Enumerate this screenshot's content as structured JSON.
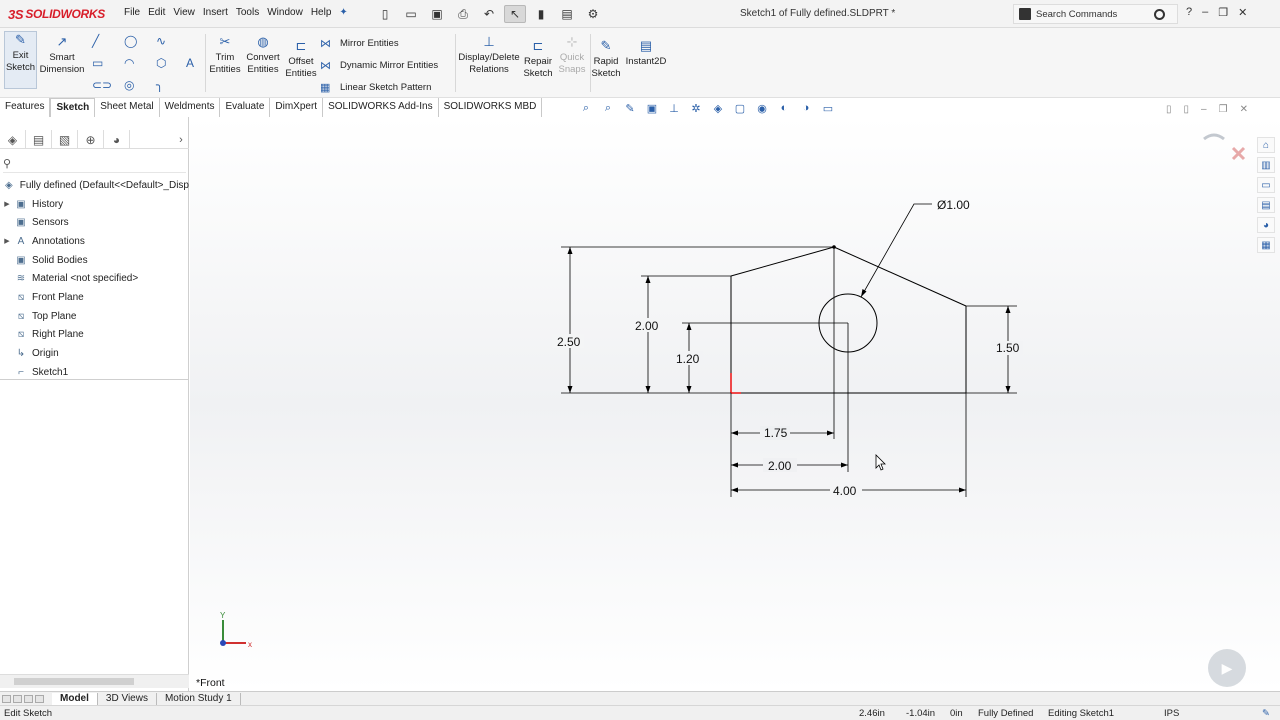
{
  "app": {
    "logo_text": "SOLIDWORKS",
    "doc_title": "Sketch1 of Fully defined.SLDPRT *",
    "menu": [
      "File",
      "Edit",
      "View",
      "Insert",
      "Tools",
      "Window",
      "Help"
    ],
    "search_placeholder": "Search Commands",
    "accent_color": "#d81e2a"
  },
  "ribbon": {
    "exit_sketch": "Exit Sketch",
    "smart_dimension": "Smart Dimension",
    "trim_entities": "Trim Entities",
    "convert_entities": "Convert Entities",
    "offset_entities": "Offset Entities",
    "mirror_entities": "Mirror Entities",
    "dynamic_mirror": "Dynamic Mirror Entities",
    "linear_pattern": "Linear Sketch Pattern",
    "display_delete_relations": "Display/Delete Relations",
    "repair_sketch": "Repair Sketch",
    "quick_snaps": "Quick Snaps",
    "rapid_sketch": "Rapid Sketch",
    "instant2d": "Instant2D"
  },
  "tabs": [
    "Features",
    "Sketch",
    "Sheet Metal",
    "Weldments",
    "Evaluate",
    "DimXpert",
    "SOLIDWORKS Add-Ins",
    "SOLIDWORKS MBD"
  ],
  "active_tab": "Sketch",
  "feature_tree": {
    "root": "Fully defined  (Default<<Default>_Disp",
    "items": [
      {
        "label": "History",
        "icon": "history-icon",
        "expandable": true
      },
      {
        "label": "Sensors",
        "icon": "sensor-icon",
        "expandable": false
      },
      {
        "label": "Annotations",
        "icon": "annotations-icon",
        "expandable": true
      },
      {
        "label": "Solid Bodies",
        "icon": "solid-bodies-icon",
        "expandable": false
      },
      {
        "label": "Material <not specified>",
        "icon": "material-icon",
        "expandable": false
      },
      {
        "label": "Front Plane",
        "icon": "plane-icon",
        "expandable": false
      },
      {
        "label": "Top Plane",
        "icon": "plane-icon",
        "expandable": false
      },
      {
        "label": "Right Plane",
        "icon": "plane-icon",
        "expandable": false
      },
      {
        "label": "Origin",
        "icon": "origin-icon",
        "expandable": false
      },
      {
        "label": "Sketch1",
        "icon": "sketch-icon",
        "expandable": false
      }
    ]
  },
  "sketch": {
    "dims": {
      "diameter": "Ø1.00",
      "height_total": "2.50",
      "height_left": "2.00",
      "hole_height": "1.20",
      "height_right": "1.50",
      "peak_x": "1.75",
      "hole_x": "2.00",
      "width": "4.00"
    },
    "axis_x": "x",
    "axis_y": "Y"
  },
  "view_name": "*Front",
  "bottom_tabs": [
    "Model",
    "3D Views",
    "Motion Study 1"
  ],
  "active_bottom_tab": "Model",
  "status": {
    "left": "Edit Sketch",
    "x": "2.46in",
    "y": "-1.04in",
    "z": "0in",
    "state": "Fully Defined",
    "editing": "Editing Sketch1",
    "units": "IPS"
  }
}
